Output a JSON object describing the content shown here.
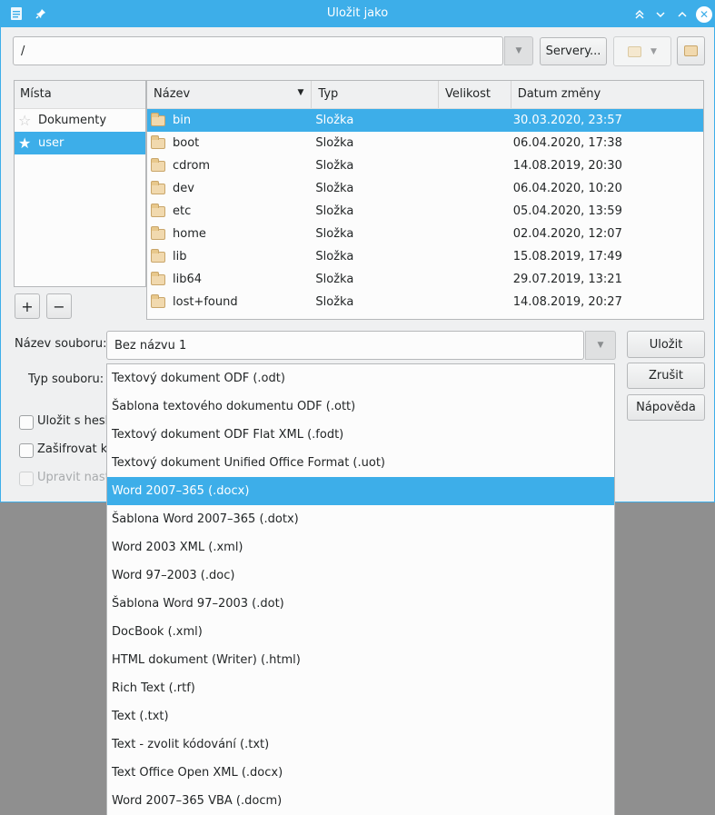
{
  "window": {
    "title": "Uložit jako",
    "icons": {
      "app": "document-icon",
      "pin": "pin-icon",
      "keep_above": "chevrons-up-icon",
      "minimize": "chevron-down-icon",
      "maximize": "chevron-up-icon",
      "close": "close-icon"
    }
  },
  "path_bar": {
    "value": "/",
    "servers_label": "Servery...",
    "folder_dropdown_icon": "folder-icon",
    "new_folder_icon": "folder-icon"
  },
  "places": {
    "header": "Místa",
    "items": [
      {
        "label": "Dokumenty",
        "icon": "star-icon",
        "selected": false
      },
      {
        "label": "user",
        "icon": "star-icon",
        "selected": true
      }
    ],
    "add_label": "+",
    "remove_label": "−"
  },
  "files": {
    "columns": {
      "name": "Název",
      "type": "Typ",
      "size": "Velikost",
      "date": "Datum změny"
    },
    "rows": [
      {
        "name": "bin",
        "type": "Složka",
        "size": "",
        "date": "30.03.2020, 23:57",
        "selected": true
      },
      {
        "name": "boot",
        "type": "Složka",
        "size": "",
        "date": "06.04.2020, 17:38",
        "selected": false
      },
      {
        "name": "cdrom",
        "type": "Složka",
        "size": "",
        "date": "14.08.2019, 20:30",
        "selected": false
      },
      {
        "name": "dev",
        "type": "Složka",
        "size": "",
        "date": "06.04.2020, 10:20",
        "selected": false
      },
      {
        "name": "etc",
        "type": "Složka",
        "size": "",
        "date": "05.04.2020, 13:59",
        "selected": false
      },
      {
        "name": "home",
        "type": "Složka",
        "size": "",
        "date": "02.04.2020, 12:07",
        "selected": false
      },
      {
        "name": "lib",
        "type": "Složka",
        "size": "",
        "date": "15.08.2019, 17:49",
        "selected": false
      },
      {
        "name": "lib64",
        "type": "Složka",
        "size": "",
        "date": "29.07.2019, 13:21",
        "selected": false
      },
      {
        "name": "lost+found",
        "type": "Složka",
        "size": "",
        "date": "14.08.2019, 20:27",
        "selected": false
      }
    ]
  },
  "form": {
    "filename_label": "Název souboru:",
    "filename_value": "Bez názvu 1",
    "filetype_label": "Typ souboru:",
    "save_label": "Uložit",
    "cancel_label": "Zrušit",
    "help_label": "Nápověda",
    "checkbox_password": "Uložit s hesle",
    "checkbox_encrypt": "Zašifrovat kl",
    "checkbox_edit": "Upravit nast"
  },
  "filetype_options": [
    {
      "label": "Textový dokument ODF (.odt)",
      "selected": false
    },
    {
      "label": "Šablona textového dokumentu ODF (.ott)",
      "selected": false
    },
    {
      "label": "Textový dokument ODF Flat XML (.fodt)",
      "selected": false
    },
    {
      "label": "Textový dokument Unified Office Format (.uot)",
      "selected": false
    },
    {
      "label": "Word 2007–365 (.docx)",
      "selected": true
    },
    {
      "label": "Šablona Word 2007–365 (.dotx)",
      "selected": false
    },
    {
      "label": "Word 2003 XML (.xml)",
      "selected": false
    },
    {
      "label": "Word 97–2003 (.doc)",
      "selected": false
    },
    {
      "label": "Šablona Word 97–2003 (.dot)",
      "selected": false
    },
    {
      "label": "DocBook (.xml)",
      "selected": false
    },
    {
      "label": "HTML dokument (Writer) (.html)",
      "selected": false
    },
    {
      "label": "Rich Text (.rtf)",
      "selected": false
    },
    {
      "label": "Text (.txt)",
      "selected": false
    },
    {
      "label": "Text - zvolit kódování (.txt)",
      "selected": false
    },
    {
      "label": "Text Office Open XML (.docx)",
      "selected": false
    },
    {
      "label": "Word 2007–365 VBA (.docm)",
      "selected": false
    }
  ]
}
